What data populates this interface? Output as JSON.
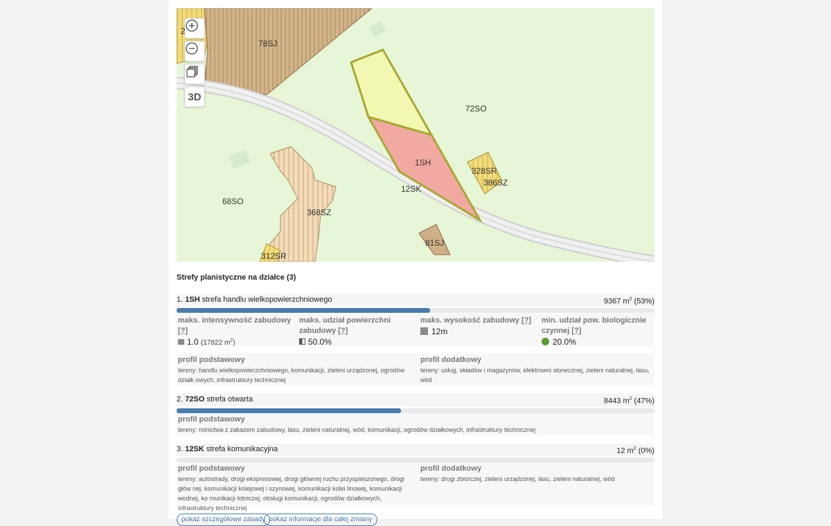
{
  "map": {
    "controls": {
      "d3_label": "3D"
    },
    "labels": {
      "z78sj": "78SJ",
      "z72so": "72SO",
      "z1sh": "1SH",
      "z328sr": "328SR",
      "z386sz": "386SZ",
      "z12sk": "12SK",
      "z68so": "68SO",
      "z368sz": "368SZ",
      "z81sj": "81SJ",
      "z312sr": "312SR",
      "zpartial": "2"
    }
  },
  "zones_title": "Strefy planistyczne na działce (3)",
  "zones": [
    {
      "num": "1.",
      "code": "1SH",
      "desc": "strefa handlu wielkopowierzchniowego",
      "area_value": "9367 m",
      "area_percent": "(53%)",
      "share": 0.53,
      "params": {
        "intensity_label": "maks. intensywność zabudowy",
        "intensity_value": "1.0",
        "intensity_extra": "(17822 m",
        "intensity_extra_close": ")",
        "coverage_label": "maks. udział powierzchni zabudowy",
        "coverage_value": "50.0%",
        "height_label": "maks. wysokość zabudowy",
        "height_value": "12m",
        "bio_label": "min. udział pow. biologicznie czynnej",
        "bio_value": "20.0%",
        "help": "[?]"
      },
      "basic_title": "profil podstawowy",
      "basic_text": "tereny: handlu wielkopowierzchniowego, komunikacji, zieleni urządzonej, ogrodów działk owych, infrastruktury technicznej",
      "extra_title": "profil dodatkowy",
      "extra_text": "tereny: usług, składów i magazynów, elektrowni słonecznej, zieleni naturalnej, lasu, wód"
    },
    {
      "num": "2.",
      "code": "72SO",
      "desc": "strefa otwarta",
      "area_value": "8443 m",
      "area_percent": "(47%)",
      "share": 0.47,
      "basic_title": "profil podstawowy",
      "basic_text": "tereny: rolnictwa z zakazem zabudowy, lasu, zieleni naturalnej, wód, komunikacji, ogrodów działkowych, infrastruktury technicznej"
    },
    {
      "num": "3.",
      "code": "12SK",
      "desc": "strefa komunikacyjna",
      "area_value": "12 m",
      "area_percent": "(0%)",
      "share": 0.0,
      "basic_title": "profil podstawowy",
      "basic_text": "tereny: autostrady, drogi ekspresowej, drogi głównej ruchu przyspieszonego, drogi głów nej, komunikacji kolejowej i szynowej, komunikacji kolei linowej, komunikacji wodnej, ko munikacji lotniczej, obsługi komunikacji, ogrodów działkowych, infrastruktury technicznej",
      "extra_title": "profil dodatkowy",
      "extra_text": "tereny: drogi zbiorczej, zieleni urządzonej, lasu, zieleni naturalnej, wód"
    }
  ],
  "buttons": {
    "general_zones": "pokaż szczegółowe zasady",
    "change_info": "pokaż informacje dla całej zmiany"
  },
  "colors": {
    "accent": "#4a7cad",
    "selected_parcel": "#f2a9a2",
    "parcel_outline": "#a8a832"
  }
}
